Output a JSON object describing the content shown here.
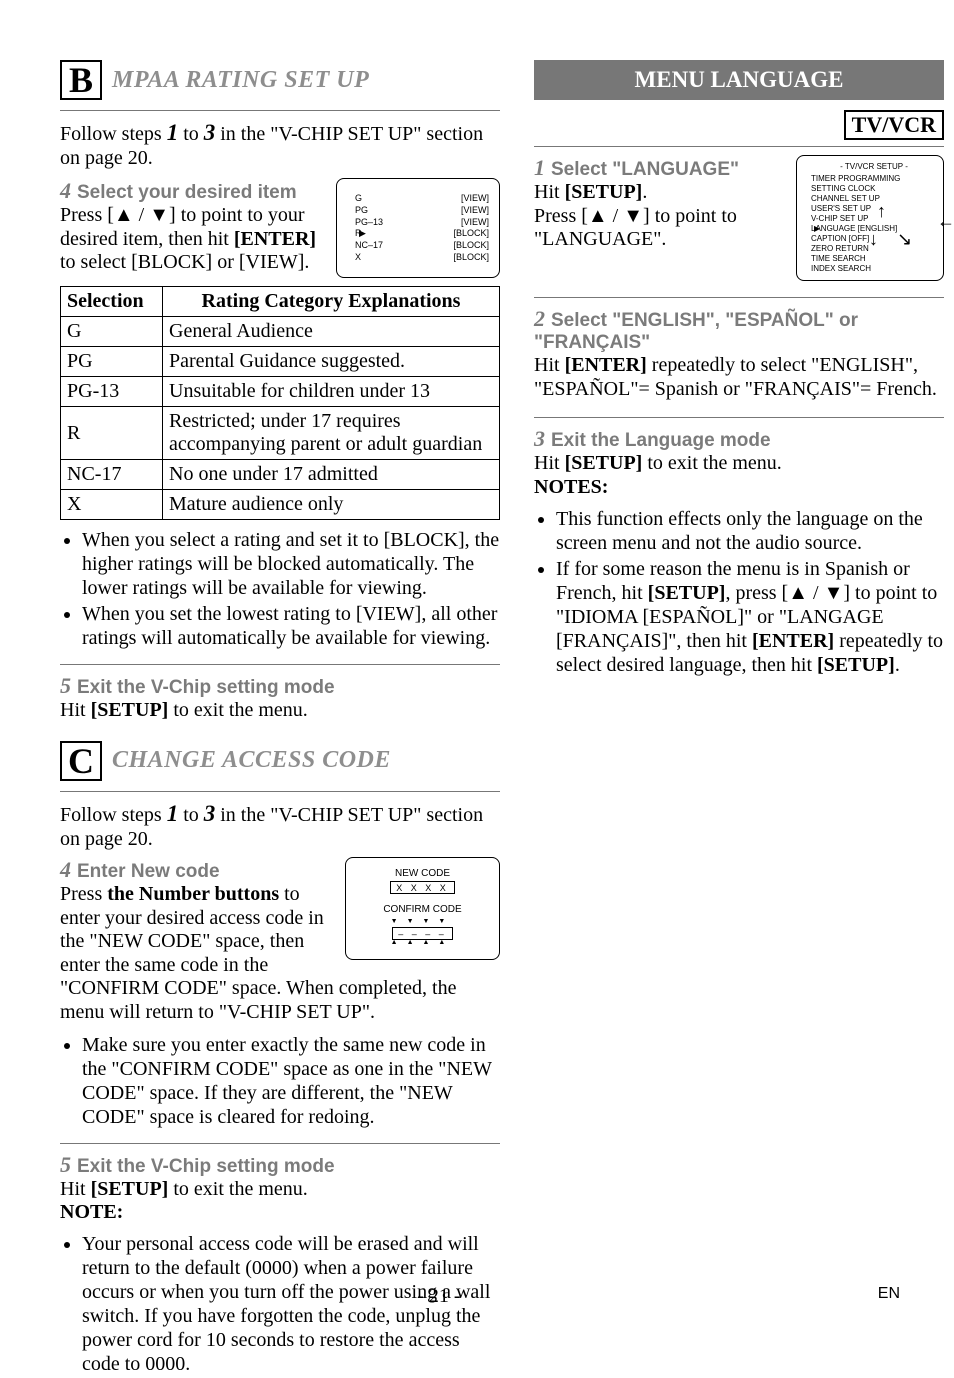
{
  "left": {
    "sectB_letter": "B",
    "sectB_title": "MPAA RATING SET UP",
    "intro_b": "Follow steps 1 to 3 in the \"V-CHIP SET UP\" section on page 20.",
    "step4b_num": "4",
    "step4b_cap": "Select your desired item",
    "step4b_body_1": "Press [▲ / ▼] to point to your desired item, then hit ",
    "step4b_body_enter": "[ENTER]",
    "step4b_body_2": " to select [BLOCK] or [VIEW].",
    "osd_mpaa": [
      {
        "l": "G",
        "r": "[VIEW]"
      },
      {
        "l": "PG",
        "r": "[VIEW]"
      },
      {
        "l": "PG–13",
        "r": "[VIEW]"
      },
      {
        "l": "R",
        "r": "[BLOCK]",
        "sel": true
      },
      {
        "l": "NC–17",
        "r": "[BLOCK]"
      },
      {
        "l": "X",
        "r": "[BLOCK]"
      }
    ],
    "ratings_head_sel": "Selection",
    "ratings_head_exp": "Rating Category Explanations",
    "ratings": [
      {
        "sel": "G",
        "exp": "General Audience"
      },
      {
        "sel": "PG",
        "exp": "Parental Guidance suggested."
      },
      {
        "sel": "PG-13",
        "exp": "Unsuitable for children under 13"
      },
      {
        "sel": "R",
        "exp": "Restricted; under 17 requires accompanying parent or adult guardian"
      },
      {
        "sel": "NC-17",
        "exp": "No one under 17 admitted"
      },
      {
        "sel": "X",
        "exp": "Mature audience only"
      }
    ],
    "bullets_b": [
      "When you select a rating and set it to [BLOCK], the higher ratings will be blocked automatically. The lower ratings will be available for viewing.",
      "When you set the lowest rating to [VIEW], all other ratings will automatically be available for viewing."
    ],
    "step5b_num": "5",
    "step5b_cap": "Exit the V-Chip setting mode",
    "step5b_body_1": "Hit ",
    "step5b_body_setup": "[SETUP]",
    "step5b_body_2": " to exit the menu.",
    "sectC_letter": "C",
    "sectC_title": "CHANGE ACCESS CODE",
    "intro_c": "Follow steps 1 to 3 in the \"V-CHIP SET UP\" section on page 20.",
    "step4c_num": "4",
    "step4c_cap": "Enter New code",
    "step4c_body_a": "Press ",
    "step4c_body_b": "the Number buttons",
    "step4c_body_c": " to enter your desired access code in the \"NEW CODE\" space, then enter the same code in the \"CONFIRM CODE\" space. When completed, the menu will return to \"V-CHIP SET UP\".",
    "osd_code_new": "NEW CODE",
    "osd_code_xxxx": "X X X X",
    "osd_code_cfm": "CONFIRM CODE",
    "osd_code_dash": "– – – –",
    "bullets_c": [
      "Make sure you enter exactly the same new code in the \"CONFIRM CODE\" space as one in the \"NEW CODE\" space. If they are different, the \"NEW CODE\" space is cleared for redoing."
    ],
    "step5c_num": "5",
    "step5c_cap": "Exit the V-Chip setting mode",
    "step5c_body_1": "Hit ",
    "step5c_body_setup": "[SETUP]",
    "step5c_body_2": " to exit the menu.",
    "note_head": "NOTE:",
    "note_bullets": [
      "Your personal access code will be erased and will return to the default (0000) when a power failure occurs or when you turn off the power using a wall switch. If you have forgotten the code, unplug the power cord for 10 seconds to restore the access code to 0000."
    ]
  },
  "right": {
    "menulang_title": "MENU LANGUAGE",
    "tvvcr": "TV/VCR",
    "step1_num": "1",
    "step1_cap": "Select \"LANGUAGE\"",
    "step1_body_a": "Hit ",
    "step1_body_setup": "[SETUP]",
    "step1_body_b": ".",
    "step1_body_c": "Press [▲ / ▼] to point to \"LANGUAGE\".",
    "osd_title": "- TV/VCR SETUP -",
    "osd_items": [
      "TIMER PROGRAMMING",
      "SETTING CLOCK",
      "CHANNEL SET UP",
      "USER'S SET UP",
      "V-CHIP SET UP",
      "LANGUAGE   [ENGLISH]",
      "CAPTION   [OFF]",
      "ZERO RETURN",
      "TIME SEARCH",
      "INDEX SEARCH"
    ],
    "step2_num": "2",
    "step2_cap": "Select \"ENGLISH\", \"ESPAÑOL\" or \"FRANÇAIS\"",
    "step2_body_a": "Hit ",
    "step2_body_enter": "[ENTER]",
    "step2_body_b": " repeatedly to select \"ENGLISH\", \"ESPAÑOL\"= Spanish or \"FRANÇAIS\"= French.",
    "step3_num": "3",
    "step3_cap": "Exit the Language mode",
    "step3_body_a": "Hit ",
    "step3_body_setup": "[SETUP]",
    "step3_body_b": " to exit the menu.",
    "notes_head": "NOTES:",
    "notes": [
      "This function effects only the language on the screen menu and not the audio source.",
      "If for some reason the menu is in Spanish or French, hit [SETUP], press [▲ / ▼] to point to \"IDIOMA [ESPAÑOL]\" or \"LANGAGE [FRANÇAIS]\", then hit [ENTER] repeatedly to select desired language, then hit [SETUP]."
    ],
    "notes_rich_1_a": "If for some reason the menu is in Spanish or French, hit ",
    "notes_rich_1_b": "[SETUP]",
    "notes_rich_1_c": ", press [▲ / ▼] to point to \"IDIOMA [ESPAÑOL]\" or \"LANGAGE [FRANÇAIS]\", then hit ",
    "notes_rich_1_d": "[ENTER]",
    "notes_rich_1_e": " repeatedly to select desired language, then hit ",
    "notes_rich_1_f": "[SETUP]",
    "notes_rich_1_g": "."
  },
  "footer": {
    "page": "- 21 -",
    "en": "EN"
  }
}
